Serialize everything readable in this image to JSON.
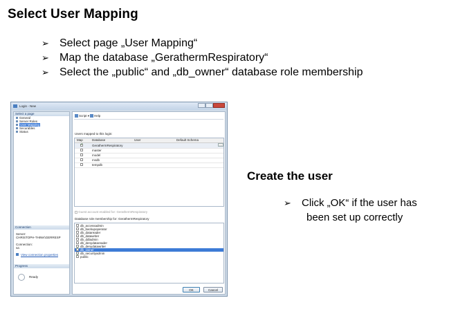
{
  "slide": {
    "title": "Select User Mapping",
    "bullets": [
      "Select page „User Mapping“",
      "Map the database „GerathermRespiratory“",
      "Select the „public“ and „db_owner“ database role membership"
    ],
    "create_title": "Create the user",
    "create_bullet_line1": "Click „OK“ if the user has",
    "create_bullet_line2": "been set up correctly"
  },
  "dialog": {
    "title": "Login - New",
    "select_page_header": "Select a page",
    "pages": [
      "General",
      "Server Roles",
      "User Mapping",
      "Securables",
      "Status"
    ],
    "selected_page_index": 2,
    "connection_header": "Connection",
    "server_label": "Server:",
    "server_value": "CHRISTOPH-THINK\\GERRESP",
    "connection_label": "Connection:",
    "connection_value": "sa",
    "view_connection_link": "View connection properties",
    "progress_header": "Progress",
    "progress_status": "Ready",
    "toolbar": {
      "script": "Script",
      "help": "Help"
    },
    "users_mapped_label": "Users mapped to this login:",
    "columns": [
      "Map",
      "Database",
      "User",
      "Default Schema"
    ],
    "databases": [
      {
        "name": "GerathermRespiratory",
        "mapped": true
      },
      {
        "name": "master",
        "mapped": false
      },
      {
        "name": "model",
        "mapped": false
      },
      {
        "name": "msdb",
        "mapped": false
      },
      {
        "name": "tempdb",
        "mapped": false
      }
    ],
    "guest_account_label": "Guest account enabled for: GerathermRespiratory",
    "role_membership_label": "Database role membership for: GerathermRespiratory",
    "roles": [
      {
        "name": "db_accessadmin",
        "checked": false
      },
      {
        "name": "db_backupoperator",
        "checked": false
      },
      {
        "name": "db_datareader",
        "checked": false
      },
      {
        "name": "db_datawriter",
        "checked": false
      },
      {
        "name": "db_ddladmin",
        "checked": false
      },
      {
        "name": "db_denydatareader",
        "checked": false
      },
      {
        "name": "db_denydatawriter",
        "checked": false
      },
      {
        "name": "db_owner",
        "checked": true
      },
      {
        "name": "db_securityadmin",
        "checked": false
      },
      {
        "name": "public",
        "checked": true
      }
    ],
    "highlighted_role_index": 7,
    "ok_label": "OK",
    "cancel_label": "Cancel"
  }
}
